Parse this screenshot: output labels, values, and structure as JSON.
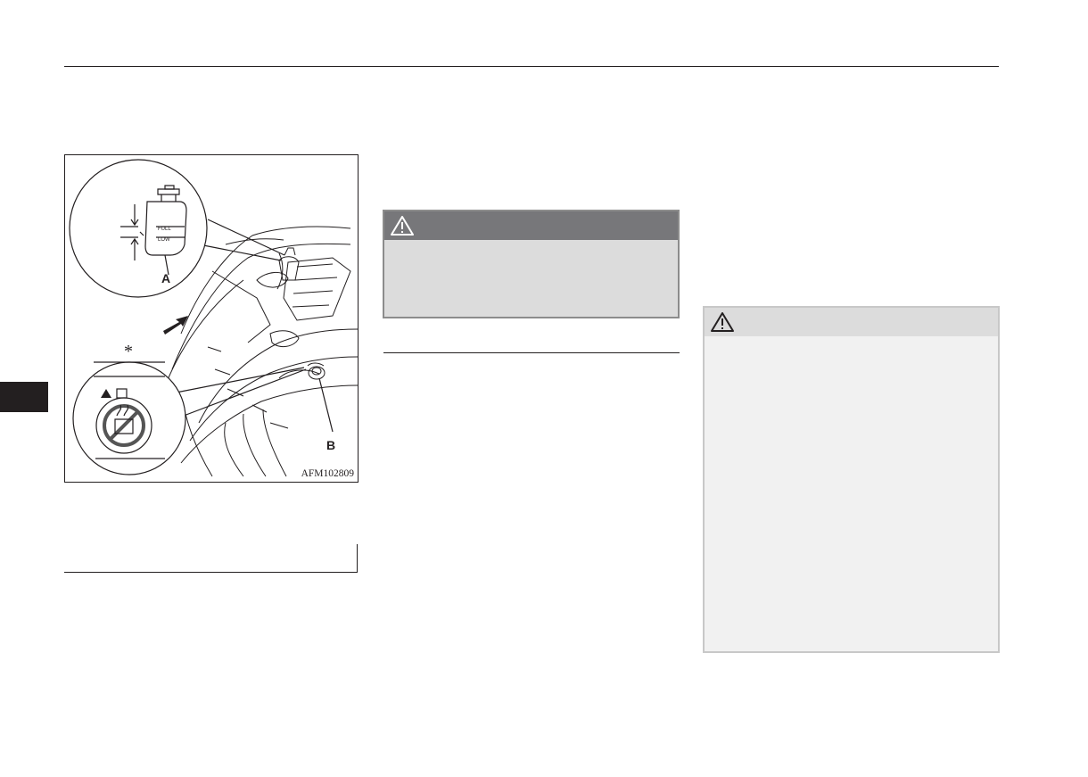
{
  "figure": {
    "code": "AFM102809",
    "callout_a": "A",
    "callout_b": "B",
    "asterisk": "*"
  },
  "warnings": [
    {
      "icon": "warning-triangle-icon"
    },
    {
      "icon": "warning-triangle-icon"
    }
  ]
}
